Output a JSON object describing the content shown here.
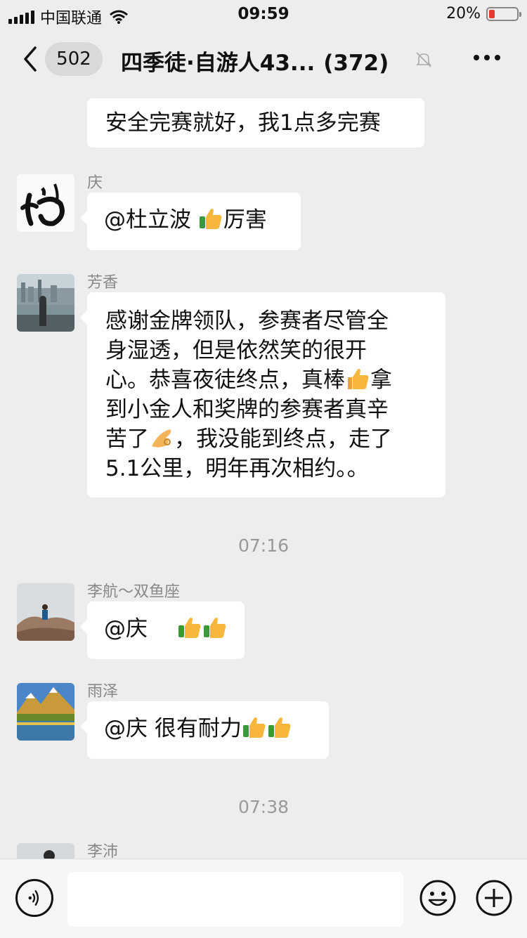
{
  "status_bar": {
    "carrier": "中国联通",
    "time": "09:59",
    "battery_percent": "20%",
    "battery_level": 0.2,
    "battery_color": "#e63b2e"
  },
  "nav": {
    "back_icon": "chevron-left-icon",
    "unread_badge": "502",
    "title": "四季徒·自游人43...",
    "member_count": "(372)",
    "mute_icon": "bell-off-icon",
    "more_icon": "more-dots-icon"
  },
  "messages": [
    {
      "sender": "",
      "text": "安全完赛就好，我1点多完赛"
    },
    {
      "sender": "庆",
      "avatar": "calligraphy-avatar",
      "text_before": "@杜立波 ",
      "emoji": "thumbs-up-icon",
      "text_after": "厉害"
    },
    {
      "sender": "芳香",
      "avatar": "city-avatar",
      "lines": [
        "感谢金牌领队，参赛者尽管全",
        "身湿透，但是依然笑的很开",
        "心。恭喜夜徒终点，真棒",
        "到小金人和奖牌的参赛者真辛",
        "苦了",
        "，我没能到终点，走了",
        "5.1公里，明年再次相约。。"
      ],
      "inline_tail_1": "拿"
    }
  ],
  "timestamp_1": "07:16",
  "messages_2": [
    {
      "sender": "李航～双鱼座",
      "avatar": "rock-avatar",
      "text": "@庆"
    },
    {
      "sender": "雨泽",
      "avatar": "mountain-lake-avatar",
      "text": "@庆 很有耐力"
    }
  ],
  "timestamp_2": "07:38",
  "messages_3": [
    {
      "sender": "李沛",
      "avatar": "person-avatar"
    }
  ],
  "input_bar": {
    "voice_icon": "voice-icon",
    "emoji_icon": "emoji-icon",
    "plus_icon": "plus-icon"
  }
}
